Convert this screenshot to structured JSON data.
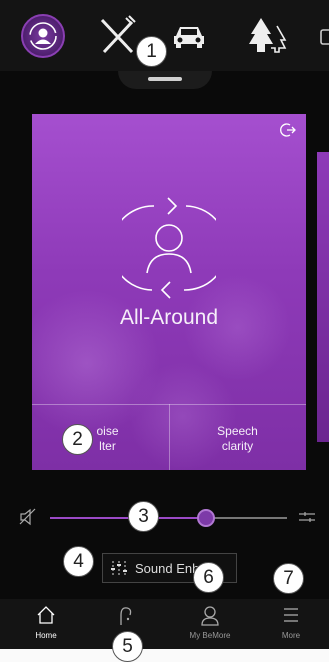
{
  "top_programs": [
    {
      "name": "all-around",
      "icon": "person-cycle-icon",
      "active": true
    },
    {
      "name": "restaurant",
      "icon": "fork-knife-icon",
      "active": false
    },
    {
      "name": "car",
      "icon": "car-icon",
      "active": false
    },
    {
      "name": "outdoor",
      "icon": "trees-icon",
      "active": false
    }
  ],
  "program_card": {
    "name": "All-Around",
    "share_icon": "share-icon",
    "options": [
      {
        "line1": "oise",
        "line2": "lter"
      },
      {
        "line1": "Speech",
        "line2": "clarity"
      }
    ]
  },
  "volume": {
    "level_fraction": 0.66,
    "mute_icon": "speaker-mute-icon",
    "eq_icon": "equalizer-icon"
  },
  "sound_enhancer": {
    "label": "Sound Enh",
    "icon": "equalizer-sliders-icon"
  },
  "callouts": [
    "1",
    "2",
    "3",
    "4",
    "5",
    "6",
    "7"
  ],
  "bottom_nav": [
    {
      "label": "Home",
      "icon": "home-icon",
      "active": true
    },
    {
      "label": "",
      "icon": "hearing-aid-icon",
      "active": false
    },
    {
      "label": "My BeMore",
      "icon": "user-icon",
      "active": false
    },
    {
      "label": "More",
      "icon": "menu-icon",
      "active": false
    }
  ],
  "colors": {
    "accent": "#8e3ab8",
    "background": "#0a0a0a",
    "nav_background": "#141414"
  }
}
